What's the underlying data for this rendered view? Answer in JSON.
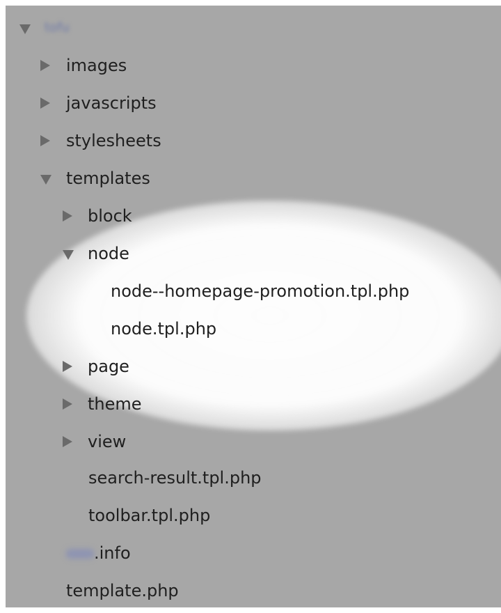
{
  "tree": {
    "root": {
      "label": "tofu",
      "expanded": true,
      "icon": "expanded-icon"
    },
    "items": [
      {
        "label": "images",
        "expanded": false,
        "icon": "collapsed-icon"
      },
      {
        "label": "javascripts",
        "expanded": false,
        "icon": "collapsed-icon"
      },
      {
        "label": "stylesheets",
        "expanded": false,
        "icon": "collapsed-icon"
      },
      {
        "label": "templates",
        "expanded": true,
        "icon": "expanded-icon"
      },
      {
        "label": "block",
        "expanded": false,
        "icon": "collapsed-icon"
      },
      {
        "label": "node",
        "expanded": true,
        "icon": "expanded-icon"
      },
      {
        "label": "node--homepage-promotion.tpl.php"
      },
      {
        "label": "node.tpl.php"
      },
      {
        "label": "page",
        "expanded": false,
        "icon": "collapsed-icon"
      },
      {
        "label": "theme",
        "expanded": false,
        "icon": "collapsed-icon"
      },
      {
        "label": "view",
        "expanded": false,
        "icon": "collapsed-icon"
      },
      {
        "label": "search-result.tpl.php"
      },
      {
        "label": "toolbar.tpl.php"
      },
      {
        "label": "tofu.info"
      },
      {
        "label": "template.php"
      }
    ],
    "info_suffix": ".info"
  },
  "colors": {
    "background": "#a7a7a7",
    "highlight": "#ffffff",
    "text": "#1f1f1f",
    "disclosure": "#6a6a6a"
  }
}
